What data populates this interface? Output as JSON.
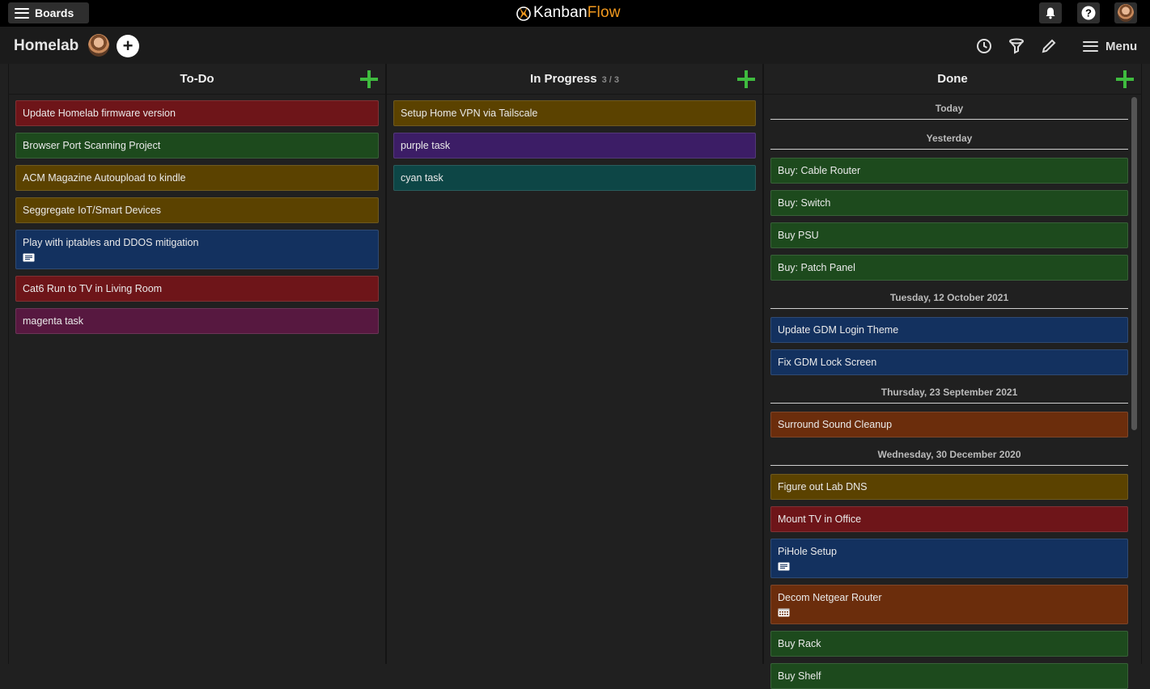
{
  "app": {
    "boards_label": "Boards",
    "logo_part1": "Kanban",
    "logo_part2": "Flow"
  },
  "board": {
    "title": "Homelab",
    "add_member_label": "+",
    "menu_label": "Menu"
  },
  "columns": {
    "todo": {
      "title": "To-Do",
      "tasks": [
        {
          "title": "Update Homelab firmware version",
          "color": "red"
        },
        {
          "title": "Browser Port Scanning Project",
          "color": "green"
        },
        {
          "title": "ACM Magazine Autoupload to kindle",
          "color": "yellow"
        },
        {
          "title": "Seggregate IoT/Smart Devices",
          "color": "yellow"
        },
        {
          "title": "Play with iptables and DDOS mitigation",
          "color": "blue",
          "icon": "comment-icon"
        },
        {
          "title": "Cat6 Run to TV in Living Room",
          "color": "red"
        },
        {
          "title": "magenta task",
          "color": "magenta"
        }
      ]
    },
    "inprogress": {
      "title": "In Progress",
      "wip": "3 / 3",
      "tasks": [
        {
          "title": "Setup Home VPN via Tailscale",
          "color": "yellow"
        },
        {
          "title": "purple task",
          "color": "purple"
        },
        {
          "title": "cyan task",
          "color": "cyan"
        }
      ]
    },
    "done": {
      "title": "Done",
      "groups": [
        {
          "date": "Today",
          "tasks": []
        },
        {
          "date": "Yesterday",
          "tasks": [
            {
              "title": "Buy: Cable Router",
              "color": "green"
            },
            {
              "title": "Buy: Switch",
              "color": "green"
            },
            {
              "title": "Buy PSU",
              "color": "green"
            },
            {
              "title": "Buy: Patch Panel",
              "color": "green"
            }
          ]
        },
        {
          "date": "Tuesday, 12 October 2021",
          "tasks": [
            {
              "title": "Update GDM Login Theme",
              "color": "blue"
            },
            {
              "title": "Fix GDM Lock Screen",
              "color": "blue"
            }
          ]
        },
        {
          "date": "Thursday, 23 September 2021",
          "tasks": [
            {
              "title": "Surround Sound Cleanup",
              "color": "orange"
            }
          ]
        },
        {
          "date": "Wednesday, 30 December 2020",
          "tasks": [
            {
              "title": "Figure out Lab DNS",
              "color": "yellow"
            },
            {
              "title": "Mount TV in Office",
              "color": "red"
            },
            {
              "title": "PiHole Setup",
              "color": "blue",
              "icon": "comment-icon"
            },
            {
              "title": "Decom Netgear Router",
              "color": "orange",
              "icon": "calendar-icon"
            },
            {
              "title": "Buy Rack",
              "color": "green"
            },
            {
              "title": "Buy Shelf",
              "color": "green"
            }
          ]
        }
      ]
    }
  }
}
